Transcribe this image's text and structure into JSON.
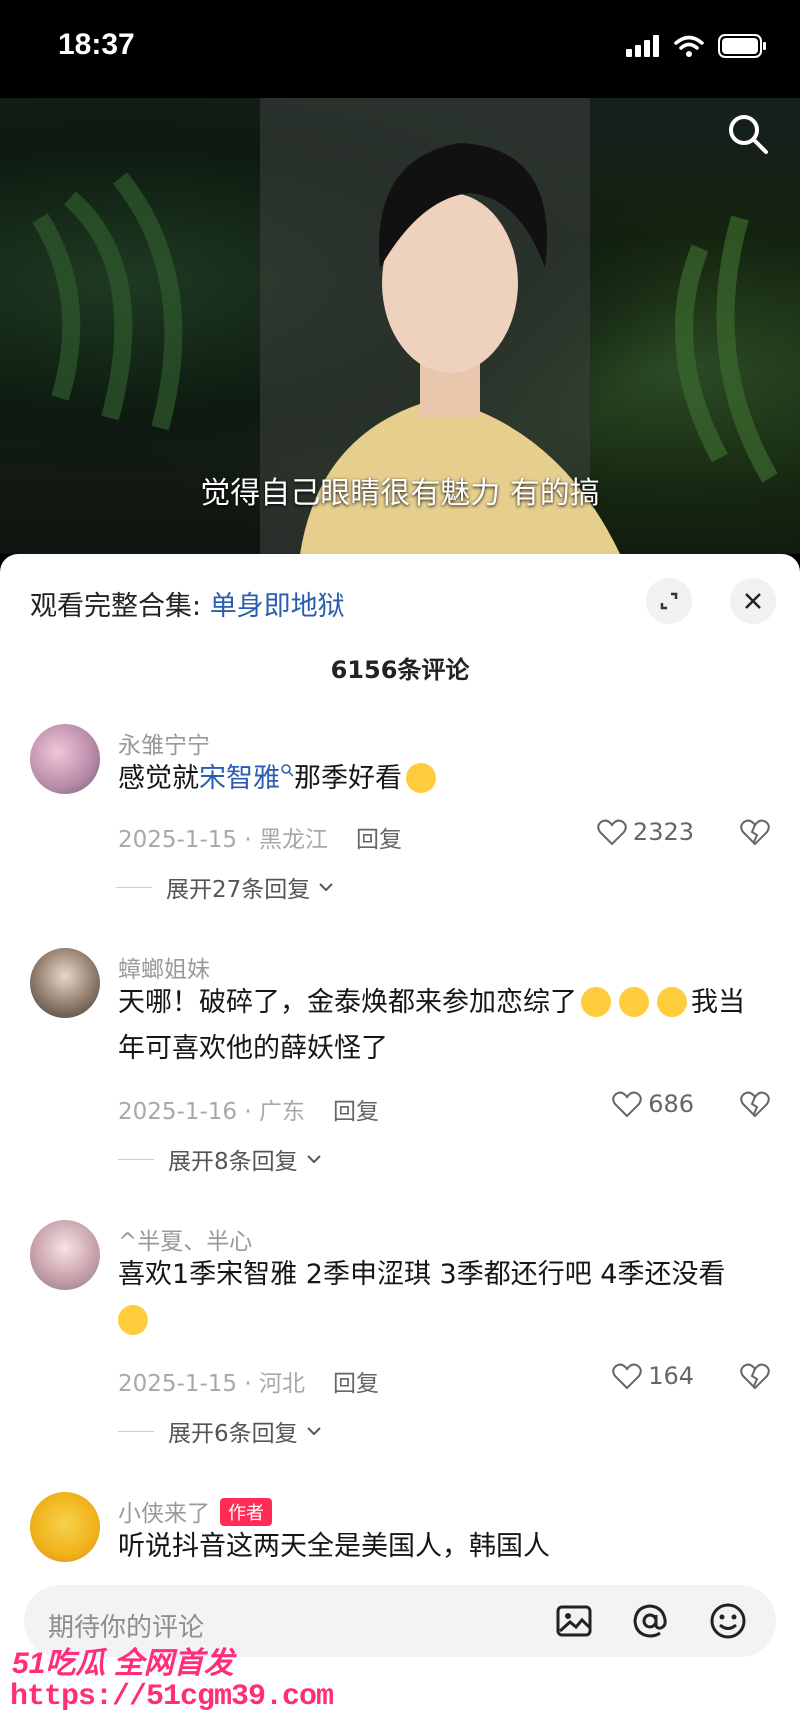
{
  "status_bar": {
    "time": "18:37"
  },
  "video": {
    "subtitle": "觉得自己眼睛很有魅力 有的搞"
  },
  "sheet": {
    "collection_prefix": "观看完整合集: ",
    "collection_name": "单身即地狱",
    "comment_count": "6156条评论"
  },
  "comments": [
    {
      "username": "永雏宁宁",
      "text_before": "感觉就",
      "text_highlight": "宋智雅",
      "text_after": "那季好看",
      "date_location": "2025-1-15 · 黑龙江",
      "reply_label": "回复",
      "likes": "2323",
      "expand_label": "展开27条回复"
    },
    {
      "username": "蟑螂姐妹",
      "text": "天哪！破碎了，金泰焕都来参加恋综了",
      "text_after": "我当年可喜欢他的薛妖怪了",
      "date_location": "2025-1-16 · 广东",
      "reply_label": "回复",
      "likes": "686",
      "expand_label": "展开8条回复"
    },
    {
      "username": "^半夏、半心",
      "text": "喜欢1季宋智雅 2季申涩琪 3季都还行吧 4季还没看",
      "date_location": "2025-1-15 · 河北",
      "reply_label": "回复",
      "likes": "164",
      "expand_label": "展开6条回复"
    },
    {
      "username": "小侠来了",
      "badge": "作者",
      "text": "听说抖音这两天全是美国人，韩国人"
    }
  ],
  "input": {
    "placeholder": "期待你的评论"
  },
  "watermark": {
    "line1": "51吃瓜 全网首发",
    "line2": "https://51cgm39.com"
  },
  "colors": {
    "link": "#2a5cb0",
    "badge": "#ff2d55",
    "watermark": "#ff2d7a"
  }
}
